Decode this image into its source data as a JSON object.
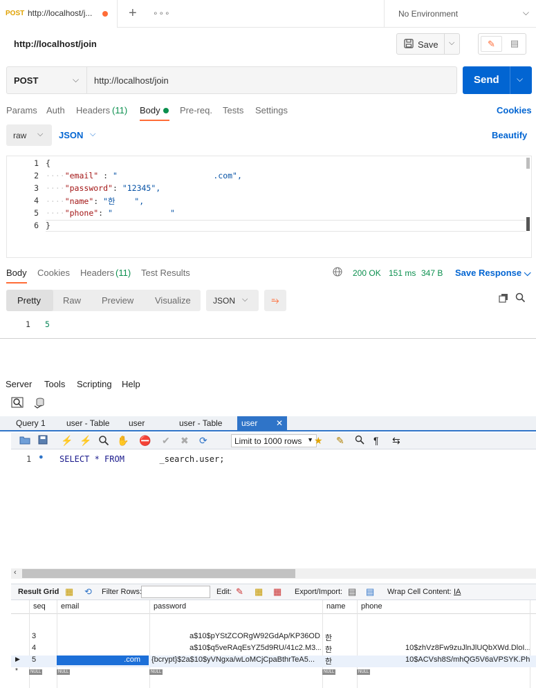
{
  "postman": {
    "tab": {
      "method": "POST",
      "url": "http://localhost/j...",
      "unsaved_dot": true
    },
    "new_tab": "+",
    "more": "ooo",
    "environment": "No Environment",
    "request_name": "http://localhost/join",
    "save_label": "Save",
    "method": "POST",
    "url": "http://localhost/join",
    "send_label": "Send",
    "request_tabs": {
      "params": "Params",
      "auth": "Auth",
      "headers": "Headers",
      "headers_count": "(11)",
      "body": "Body",
      "prereq": "Pre-req.",
      "tests": "Tests",
      "settings": "Settings"
    },
    "cookies": "Cookies",
    "body_mode": "raw",
    "body_format": "JSON",
    "beautify": "Beautify",
    "body_lines": [
      "1",
      "2",
      "3",
      "4",
      "5",
      "6"
    ],
    "body_code": {
      "l1": "{",
      "l2_key": "\"email\"",
      "l2_val": "\"                    .com\",",
      "l3_key": "\"password\"",
      "l3_val": "\"12345\",",
      "l4_key": "\"name\"",
      "l4_val": "\"한    \",",
      "l5_key": "\"phone\"",
      "l5_val": "\"            \"",
      "l6": "}"
    },
    "response_tabs": {
      "body": "Body",
      "cookies": "Cookies",
      "headers": "Headers",
      "headers_count": "(11)",
      "test_results": "Test Results"
    },
    "status": "200 OK",
    "time": "151 ms",
    "size": "347 B",
    "save_response": "Save Response",
    "view_tabs": [
      "Pretty",
      "Raw",
      "Preview",
      "Visualize"
    ],
    "response_format": "JSON",
    "response_line": "1",
    "response_value": "5"
  },
  "workbench": {
    "menu": [
      "Server",
      "Tools",
      "Scripting",
      "Help"
    ],
    "tabs": [
      "Query 1",
      "user - Table",
      "user",
      "user - Table"
    ],
    "active_tab": "user",
    "limit": "Limit to 1000 rows",
    "sql_line": "1",
    "sql_keywords": "SELECT * FROM",
    "sql_table": "      _search.user;",
    "result_grid": "Result Grid",
    "filter_rows": "Filter Rows:",
    "edit": "Edit:",
    "export_import": "Export/Import:",
    "wrap": "Wrap Cell Content:",
    "columns": [
      "seq",
      "email",
      "password",
      "name",
      "phone"
    ],
    "rows": [
      {
        "seq": "3",
        "email": "",
        "password": "a$10$pYStZCORgW92GdAp/KP36OD...",
        "name": "한",
        "phone": ""
      },
      {
        "seq": "4",
        "email": "",
        "password": "a$10$q5veRAqEsYZ5d9RU/41c2.M3...",
        "name": "한",
        "phone": "10$zhVz8Fw9zuJlnJlUQbXWd.DloI..."
      },
      {
        "seq": "5",
        "email": ".com",
        "password": "{bcrypt}$2a$10$yVNgxa/wLoMCjCpaBthrTeA5...",
        "name": "한",
        "phone": "10$ACVsh8S/mhQG5V6aVPSYK.Ph..."
      }
    ],
    "null_label": "NULL"
  }
}
